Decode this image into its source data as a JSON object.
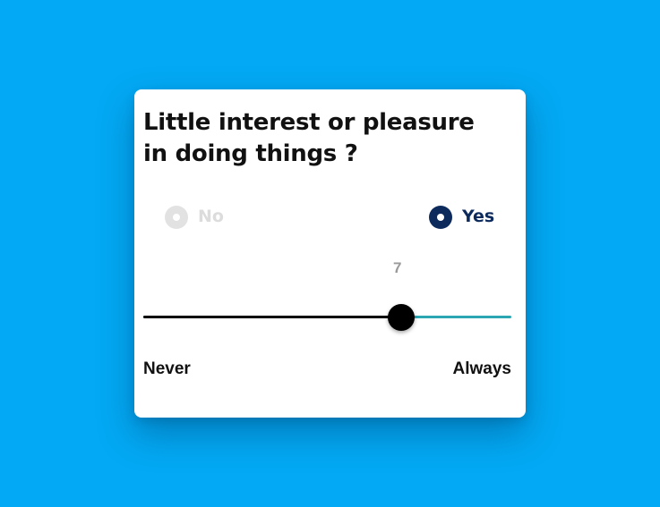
{
  "question": {
    "text": "Little interest or pleasure in doing things ?"
  },
  "options": {
    "no": {
      "label": "No",
      "selected": false
    },
    "yes": {
      "label": "Yes",
      "selected": true
    }
  },
  "slider": {
    "value_label": "7",
    "value": 7,
    "min": 0,
    "max": 10,
    "min_label": "Never",
    "max_label": "Always"
  },
  "colors": {
    "background": "#03A9F4",
    "selected_radio": "#0d2a5c",
    "unselected_radio": "#e2e2e2",
    "track_active": "#000000",
    "track_inactive": "#2aa7b3"
  }
}
